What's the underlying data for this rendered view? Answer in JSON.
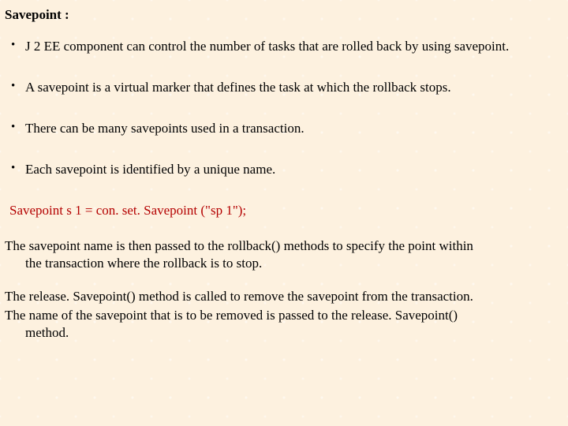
{
  "heading": "Savepoint :",
  "bullets": [
    "J 2 EE component can control the number of tasks that are rolled back by using savepoint.",
    "A  savepoint  is a virtual marker that defines the task at which the rollback stops.",
    "There can be  many savepoints used  in a transaction.",
    "Each savepoint is identified by a unique name."
  ],
  "code": "Savepoint s 1 = con. set. Savepoint (\"sp 1\");",
  "para1_a": "The savepoint name is then passed to the rollback() methods to specify the point within",
  "para1_b": "the transaction  where the rollback is to stop.",
  "para2": "The release. Savepoint() method is called to remove the savepoint from the transaction.",
  "para3_a": "The name of  the savepoint that is to be removed is passed to the release. Savepoint()",
  "para3_b": "method."
}
